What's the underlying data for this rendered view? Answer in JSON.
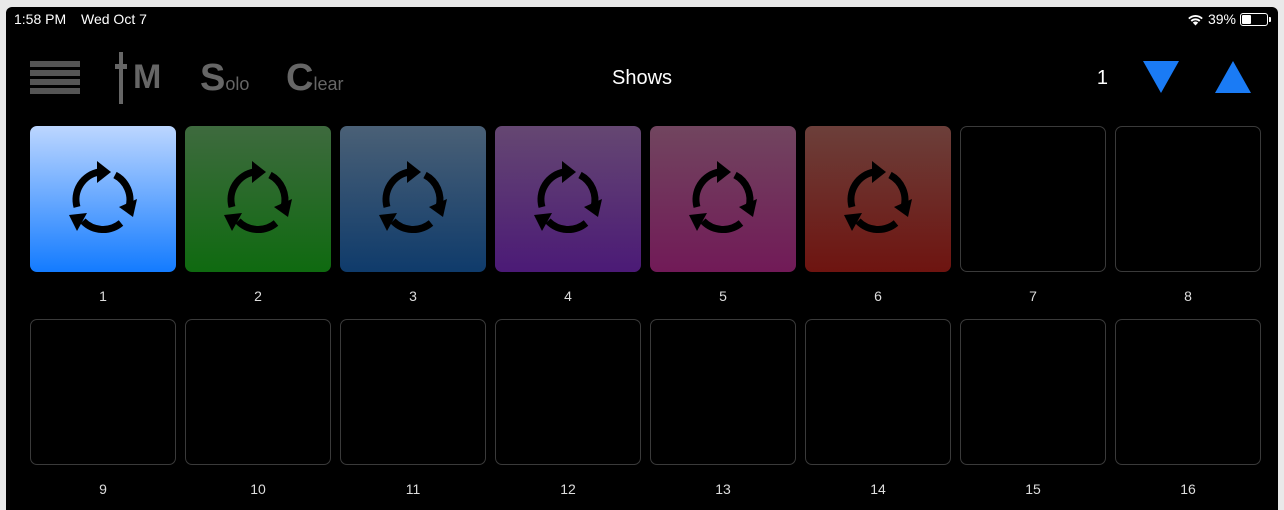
{
  "status_bar": {
    "time": "1:58 PM",
    "date": "Wed Oct 7",
    "battery": "39%",
    "battery_level": 0.39
  },
  "toolbar": {
    "im_label": "M",
    "solo": {
      "initial": "S",
      "rest": "olo"
    },
    "clear": {
      "initial": "C",
      "rest": "lear"
    },
    "title": "Shows",
    "page_number": "1",
    "arrow_color": "#1a7bf5"
  },
  "icons": {
    "menu": "hamburger-icon",
    "pad": "cycle-arrows-icon",
    "down": "triangle-down-icon",
    "up": "triangle-up-icon"
  },
  "pads": [
    {
      "number": "1",
      "color_top": "#bcd6ff",
      "color_bottom": "#137bff",
      "active": true
    },
    {
      "number": "2",
      "color_top": "#3e6a3e",
      "color_bottom": "#0f6a10",
      "active": true
    },
    {
      "number": "3",
      "color_top": "#4a6076",
      "color_bottom": "#0f3b6b",
      "active": true
    },
    {
      "number": "4",
      "color_top": "#654772",
      "color_bottom": "#4b1a76",
      "active": true
    },
    {
      "number": "5",
      "color_top": "#71455f",
      "color_bottom": "#711a57",
      "active": true
    },
    {
      "number": "6",
      "color_top": "#6c3f3a",
      "color_bottom": "#6e1410",
      "active": true
    },
    {
      "number": "7",
      "active": false
    },
    {
      "number": "8",
      "active": false
    },
    {
      "number": "9",
      "active": false
    },
    {
      "number": "10",
      "active": false
    },
    {
      "number": "11",
      "active": false
    },
    {
      "number": "12",
      "active": false
    },
    {
      "number": "13",
      "active": false
    },
    {
      "number": "14",
      "active": false
    },
    {
      "number": "15",
      "active": false
    },
    {
      "number": "16",
      "active": false
    }
  ]
}
